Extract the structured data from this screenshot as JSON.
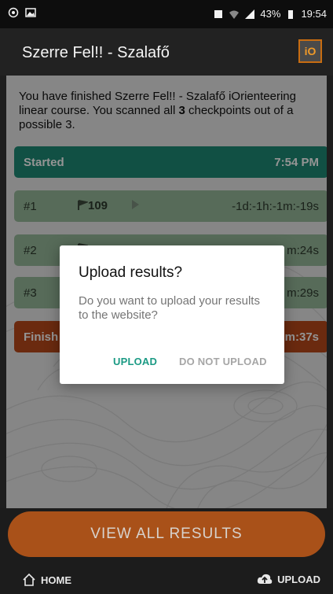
{
  "status": {
    "battery": "43%",
    "time": "19:54"
  },
  "appbar": {
    "title": "Szerre Fel!! - Szalafő",
    "logo_text": "iO"
  },
  "summary": {
    "part1": "You have finished Szerre Fel!! - Szalafő iOrienteering linear course. You scanned all ",
    "count": "3",
    "part2": " checkpoints out of a possible 3."
  },
  "rows": {
    "started": {
      "label": "Started",
      "time": "7:54 PM"
    },
    "cp1": {
      "num": "#1",
      "flag": "109",
      "time": "-1d:-1h:-1m:-19s"
    },
    "cp2": {
      "num": "#2",
      "time": "m:24s"
    },
    "cp3": {
      "num": "#3",
      "time": "m:29s"
    },
    "finish": {
      "label": "Finish",
      "time": "m:37s"
    }
  },
  "dialog": {
    "title": "Upload results?",
    "message": "Do you want to upload your results to the website?",
    "upload_label": "UPLOAD",
    "no_upload_label": "DO NOT UPLOAD"
  },
  "bottom": {
    "view_all_label": "VIEW ALL RESULTS",
    "home_label": "HOME",
    "upload_label": "UPLOAD"
  },
  "colors": {
    "accent": "#1b9a84",
    "started": "#1e8b76",
    "finish": "#b9491b",
    "cta": "#a95119"
  }
}
